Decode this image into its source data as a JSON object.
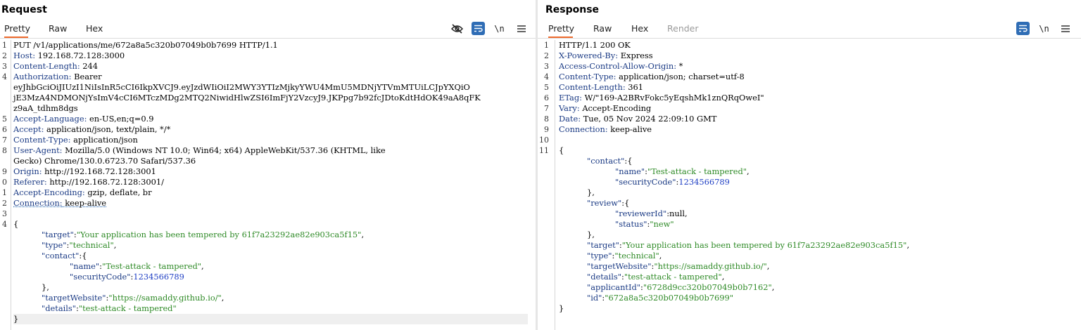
{
  "request": {
    "title": "Request",
    "tabs": [
      {
        "label": "Pretty",
        "active": true
      },
      {
        "label": "Raw",
        "active": false
      },
      {
        "label": "Hex",
        "active": false
      }
    ],
    "newline_label": "\\n",
    "lines": [
      {
        "num": "1",
        "text": "PUT /v1/applications/me/672a8a5c320b07049b0b7699 HTTP/1.1"
      },
      {
        "num": "2",
        "key": "Host:",
        "text": " 192.168.72.128:3000"
      },
      {
        "num": "3",
        "key": "Content-Length:",
        "text": " 244"
      },
      {
        "num": "4",
        "key": "Authorization:",
        "text": " Bearer"
      },
      {
        "num": "",
        "text": "eyJhbGciOiJIUzI1NiIsInR5cCI6IkpXVCJ9.eyJzdWIiOiI2MWY3YTIzMjkyYWU4MmU5MDNjYTVmMTUiLCJpYXQiO"
      },
      {
        "num": "",
        "text": "jE3MzA4NDMONjYsImV4cCI6MTczMDg2MTQ2NiwidHlwZSI6ImFjY2VzcyJ9.JKPpg7b92fcJDtoKdtHdOK49aA8qFK"
      },
      {
        "num": "",
        "text": "z9aA_tdhm8dgs"
      },
      {
        "num": "5",
        "key": "Accept-Language:",
        "text": " en-US,en;q=0.9"
      },
      {
        "num": "6",
        "key": "Accept:",
        "text": " application/json, text/plain, */*"
      },
      {
        "num": "7",
        "key": "Content-Type:",
        "text": " application/json"
      },
      {
        "num": "8",
        "key": "User-Agent:",
        "text": " Mozilla/5.0 (Windows NT 10.0; Win64; x64) AppleWebKit/537.36 (KHTML, like"
      },
      {
        "num": "",
        "text": "Gecko) Chrome/130.0.6723.70 Safari/537.36"
      },
      {
        "num": "9",
        "key": "Origin:",
        "text": " http://192.168.72.128:3001"
      },
      {
        "num": "0",
        "key": "Referer:",
        "text": " http://192.168.72.128:3001/"
      },
      {
        "num": "1",
        "key": "Accept-Encoding:",
        "text": " gzip, deflate, br"
      },
      {
        "num": "2",
        "key": "Connection:",
        "text": " keep-alive",
        "dotted": true
      },
      {
        "num": "3",
        "text": ""
      },
      {
        "num": "4",
        "text": "{"
      },
      {
        "num": "",
        "indent": 1,
        "key": "\"target\"",
        "text": ":",
        "str": "\"Your application has been tempered by 61f7a23292ae82e903ca5f15\"",
        "after": ","
      },
      {
        "num": "",
        "indent": 1,
        "key": "\"type\"",
        "text": ":",
        "str": "\"technical\"",
        "after": ","
      },
      {
        "num": "",
        "indent": 1,
        "key": "\"contact\"",
        "text": ":{"
      },
      {
        "num": "",
        "indent": 2,
        "key": "\"name\"",
        "text": ":",
        "str": "\"Test-attack - tampered\"",
        "after": ","
      },
      {
        "num": "",
        "indent": 2,
        "key": "\"securityCode\"",
        "text": ":",
        "numv": "1234566789"
      },
      {
        "num": "",
        "indent": 1,
        "text": "},"
      },
      {
        "num": "",
        "indent": 1,
        "key": "\"targetWebsite\"",
        "text": ":",
        "str": "\"https://samaddy.github.io/\"",
        "after": ","
      },
      {
        "num": "",
        "indent": 1,
        "key": "\"details\"",
        "text": ":",
        "str": "\"test-attack - tampered\""
      },
      {
        "num": "",
        "text": "}",
        "highlight": true
      }
    ]
  },
  "response": {
    "title": "Response",
    "tabs": [
      {
        "label": "Pretty",
        "active": true
      },
      {
        "label": "Raw",
        "active": false
      },
      {
        "label": "Hex",
        "active": false
      },
      {
        "label": "Render",
        "active": false,
        "disabled": true
      }
    ],
    "newline_label": "\\n",
    "lines": [
      {
        "num": "1",
        "text": "HTTP/1.1 200 OK"
      },
      {
        "num": "2",
        "key": "X-Powered-By:",
        "text": " Express"
      },
      {
        "num": "3",
        "key": "Access-Control-Allow-Origin:",
        "text": " *"
      },
      {
        "num": "4",
        "key": "Content-Type:",
        "text": " application/json; charset=utf-8"
      },
      {
        "num": "5",
        "key": "Content-Length:",
        "text": " 361"
      },
      {
        "num": "6",
        "key": "ETag:",
        "text": " W/\"169-A2BRvFokc5yEqshMk1znQRqOweI\""
      },
      {
        "num": "7",
        "key": "Vary:",
        "text": " Accept-Encoding"
      },
      {
        "num": "8",
        "key": "Date:",
        "text": " Tue, 05 Nov 2024 22:09:10 GMT"
      },
      {
        "num": "9",
        "key": "Connection:",
        "text": " keep-alive"
      },
      {
        "num": "10",
        "text": ""
      },
      {
        "num": "11",
        "text": "{"
      },
      {
        "num": "",
        "indent": 1,
        "key": "\"contact\"",
        "text": ":{"
      },
      {
        "num": "",
        "indent": 2,
        "key": "\"name\"",
        "text": ":",
        "str": "\"Test-attack - tampered\"",
        "after": ","
      },
      {
        "num": "",
        "indent": 2,
        "key": "\"securityCode\"",
        "text": ":",
        "numv": "1234566789"
      },
      {
        "num": "",
        "indent": 1,
        "text": "},"
      },
      {
        "num": "",
        "indent": 1,
        "key": "\"review\"",
        "text": ":{"
      },
      {
        "num": "",
        "indent": 2,
        "key": "\"reviewerId\"",
        "text": ":null,"
      },
      {
        "num": "",
        "indent": 2,
        "key": "\"status\"",
        "text": ":",
        "str": "\"new\""
      },
      {
        "num": "",
        "indent": 1,
        "text": "},"
      },
      {
        "num": "",
        "indent": 1,
        "key": "\"target\"",
        "text": ":",
        "str": "\"Your application has been tempered by 61f7a23292ae82e903ca5f15\"",
        "after": ","
      },
      {
        "num": "",
        "indent": 1,
        "key": "\"type\"",
        "text": ":",
        "str": "\"technical\"",
        "after": ","
      },
      {
        "num": "",
        "indent": 1,
        "key": "\"targetWebsite\"",
        "text": ":",
        "str": "\"https://samaddy.github.io/\"",
        "after": ","
      },
      {
        "num": "",
        "indent": 1,
        "key": "\"details\"",
        "text": ":",
        "str": "\"test-attack - tampered\"",
        "after": ","
      },
      {
        "num": "",
        "indent": 1,
        "key": "\"applicantId\"",
        "text": ":",
        "str": "\"6728d9cc320b07049b0b7162\"",
        "after": ","
      },
      {
        "num": "",
        "indent": 1,
        "key": "\"id\"",
        "text": ":",
        "str": "\"672a8a5c320b07049b0b7699\""
      },
      {
        "num": "",
        "text": "}"
      }
    ]
  },
  "colors": {
    "accent": "#ef6a2c",
    "wrap_button": "#2f6db5",
    "header_key": "#1a3a84",
    "json_string": "#2e8a26",
    "json_number": "#1f3fc4"
  }
}
